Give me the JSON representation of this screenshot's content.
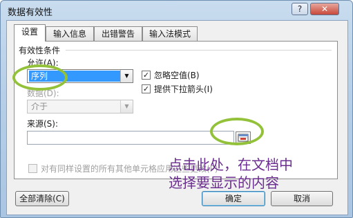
{
  "window": {
    "title": "数据有效性",
    "help_label": "?",
    "close_label": "✕"
  },
  "tabs": [
    {
      "label": "设置",
      "active": true
    },
    {
      "label": "输入信息",
      "active": false
    },
    {
      "label": "出错警告",
      "active": false
    },
    {
      "label": "输入法模式",
      "active": false
    }
  ],
  "settings": {
    "group_title": "有效性条件",
    "allow_label": "允许(A):",
    "allow_value": "序列",
    "ignore_blank_label": "忽略空值(B)",
    "ignore_blank_checked": true,
    "dropdown_label": "提供下拉箭头(I)",
    "dropdown_checked": true,
    "data_label": "数据(D):",
    "data_value": "介于",
    "source_label": "来源(S):",
    "source_value": "",
    "apply_all_label": "对有同样设置的所有其他单元格应用这些更改(P)",
    "apply_all_checked": false
  },
  "buttons": {
    "clear_all": "全部清除(C)",
    "ok": "确定",
    "cancel": "取消"
  },
  "annotation": {
    "line1": "点击此处，在文档中",
    "line2": "选择要显示的内容"
  },
  "colors": {
    "highlight_circle": "#93c23a",
    "annotation_text": "#6b2d8f",
    "selection": "#3399ff"
  }
}
